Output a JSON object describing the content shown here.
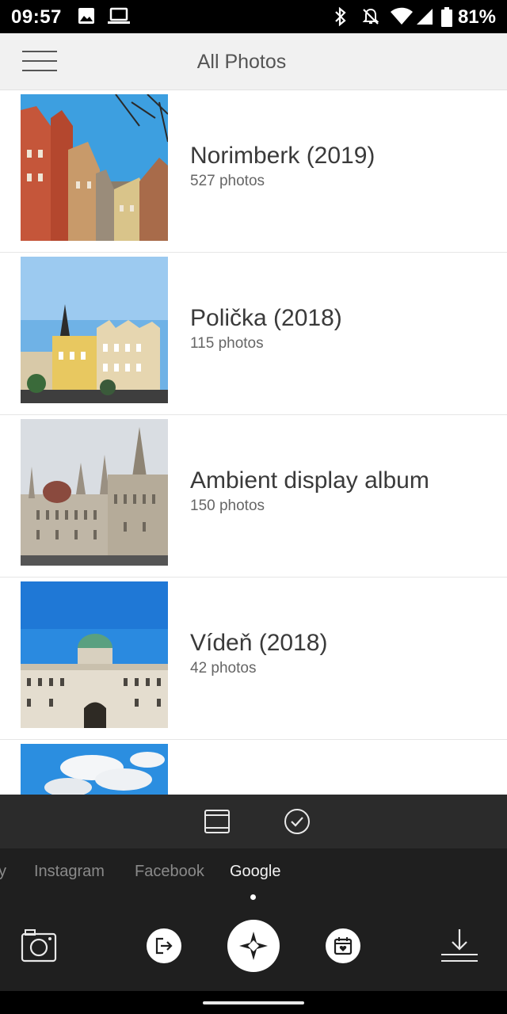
{
  "status_bar": {
    "time": "09:57",
    "battery": "81%",
    "icons": [
      "image-icon",
      "laptop-icon",
      "bluetooth-icon",
      "notifications-off-icon",
      "wifi-icon",
      "signal-icon",
      "battery-icon"
    ]
  },
  "header": {
    "title": "All Photos",
    "menu_icon": "hamburger-menu-icon"
  },
  "albums": [
    {
      "name": "Norimberk (2019)",
      "count": "527 photos"
    },
    {
      "name": "Polička (2018)",
      "count": "115 photos"
    },
    {
      "name": "Ambient display album",
      "count": "150 photos"
    },
    {
      "name": "Vídeň (2018)",
      "count": "42 photos"
    }
  ],
  "action_bar": {
    "icons": [
      "layout-icon",
      "select-check-icon"
    ]
  },
  "source_tabs": {
    "items": [
      "y",
      "Instagram",
      "Facebook",
      "Google"
    ],
    "active": "Google"
  },
  "bottom_nav": {
    "icons": [
      "camera-icon",
      "share-icon",
      "hp-sprocket-icon",
      "calendar-heart-icon",
      "download-icon"
    ]
  },
  "colors": {
    "header_bg": "#f1f1f1",
    "toolbar_bg": "#2b2b2b",
    "nav_bg": "#1f1f1f",
    "accent": "#ffffff"
  }
}
